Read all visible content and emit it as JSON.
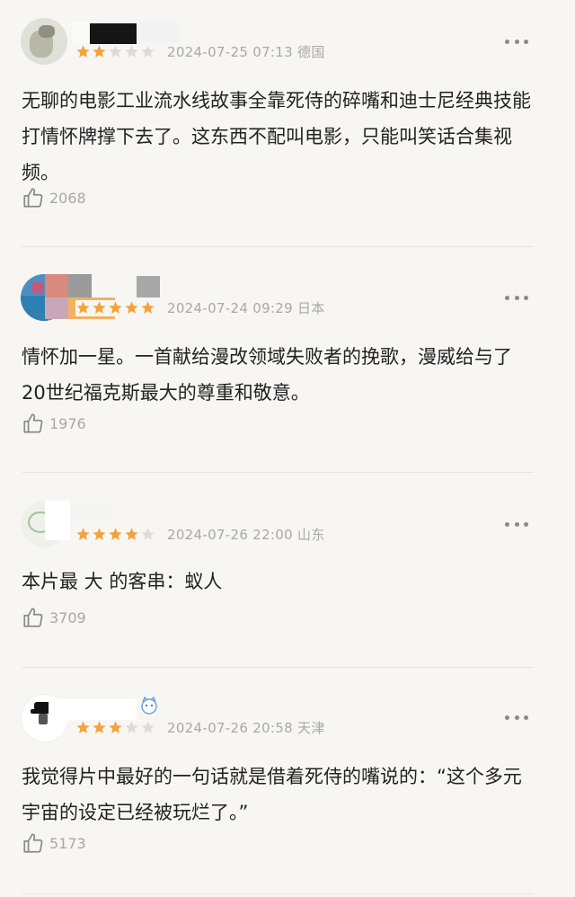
{
  "colors": {
    "star_on": "#f2a33a",
    "star_off": "#dedcd7",
    "meta_text": "#aaa8a3",
    "divider": "#e6e4df",
    "background": "#f7f6f3"
  },
  "reviews": [
    {
      "rating": 2,
      "date": "2024-07-25 07:13",
      "location": "德国",
      "text": "无聊的电影工业流水线故事全靠死侍的碎嘴和迪士尼经典技能打情怀牌撑下去了。这东西不配叫电影，只能叫笑话合集视频。",
      "likes": "2068",
      "more_icon": "more-dots-icon",
      "like_icon": "thumbs-up-icon"
    },
    {
      "rating": 5,
      "date": "2024-07-24 09:29",
      "location": "日本",
      "text": "情怀加一星。一首献给漫改领域失败者的挽歌，漫威给与了20世纪福克斯最大的尊重和敬意。",
      "likes": "1976",
      "more_icon": "more-dots-icon",
      "like_icon": "thumbs-up-icon"
    },
    {
      "rating": 4,
      "date": "2024-07-26 22:00",
      "location": "山东",
      "text": "本片最 大 的客串：蚁人",
      "likes": "3709",
      "more_icon": "more-dots-icon",
      "like_icon": "thumbs-up-icon"
    },
    {
      "rating": 3,
      "date": "2024-07-26 20:58",
      "location": "天津",
      "text": "我觉得片中最好的一句话就是借着死侍的嘴说的：“这个多元宇宙的设定已经被玩烂了。”",
      "likes": "5173",
      "more_icon": "more-dots-icon",
      "like_icon": "thumbs-up-icon"
    }
  ]
}
